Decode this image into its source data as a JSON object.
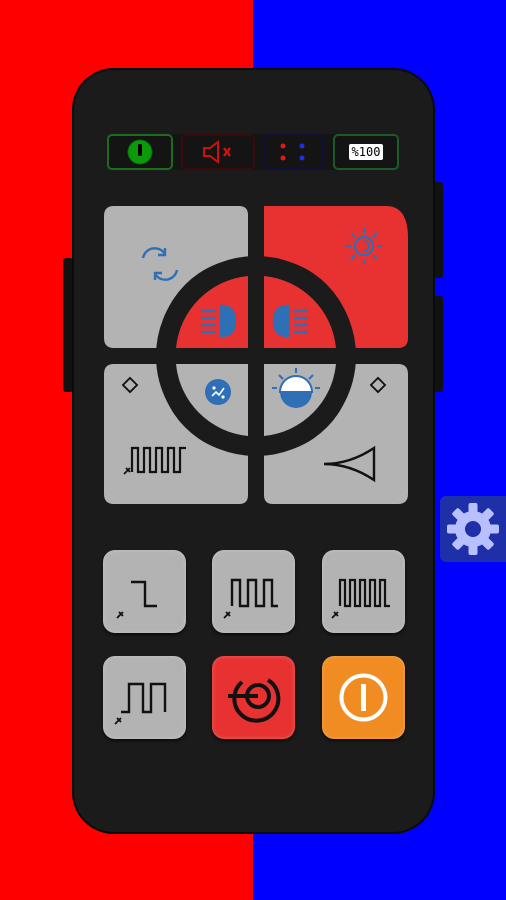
{
  "colors": {
    "left_bg": "#fe0000",
    "right_bg": "#0000fe",
    "button_gray": "#b3b3b3",
    "button_red": "#e83232",
    "button_orange": "#f08c21",
    "icon_blue": "#2f6fb5"
  },
  "status": {
    "power_indicator_icon": "power-icon",
    "mute_indicator_icon": "speaker-muted-icon",
    "light_dots_icon": "red-blue-dots-icon",
    "volume_label": "%100"
  },
  "dpad": {
    "top_left": {
      "icon": "sync-icon"
    },
    "top_right": {
      "icon": "sun-icon"
    },
    "inner_top_left": {
      "icon": "low-beam-icon"
    },
    "inner_top_right": {
      "icon": "high-beam-icon"
    },
    "inner_bottom_left": {
      "icon": "dim-icon"
    },
    "inner_bottom_right": {
      "icon": "bright-icon"
    },
    "bottom_left": {
      "icon": "wail-siren-icon"
    },
    "bottom_right": {
      "icon": "horn-icon"
    }
  },
  "grid": [
    {
      "icon": "step-wave-icon"
    },
    {
      "icon": "square-wave-icon"
    },
    {
      "icon": "fast-square-wave-icon"
    },
    {
      "icon": "pulse-wave-icon"
    },
    {
      "icon": "broadcast-icon"
    },
    {
      "icon": "power-icon"
    }
  ],
  "settings": {
    "icon": "gear-icon"
  }
}
